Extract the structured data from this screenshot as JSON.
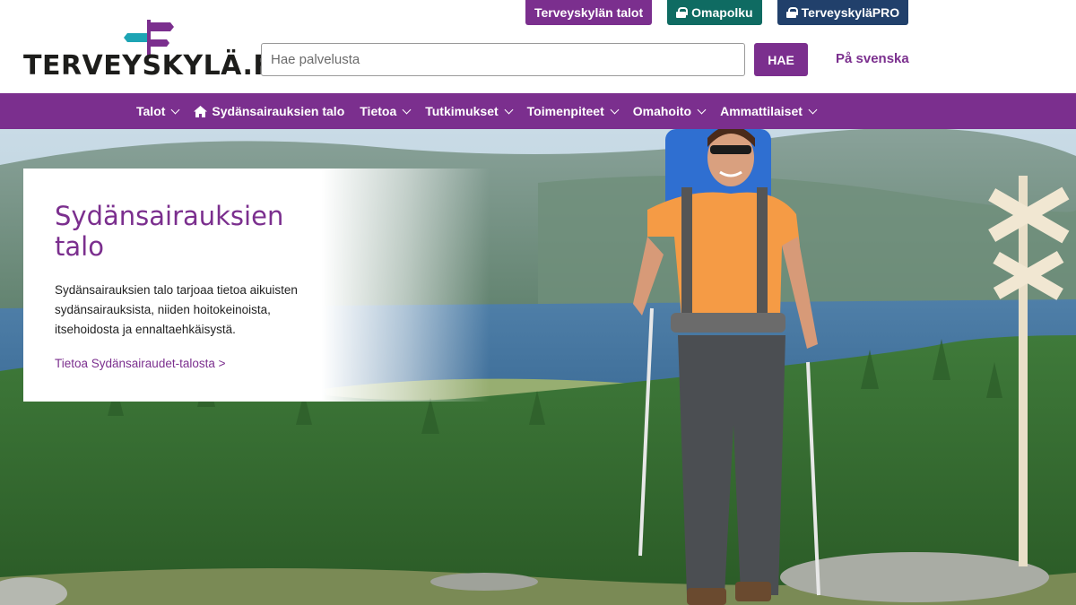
{
  "header": {
    "logo_text": "TERVEYSKYLÄ.FI",
    "top_links": [
      {
        "label": "Terveyskylän talot"
      },
      {
        "label": "Omapolku",
        "icon": "lock-icon"
      },
      {
        "label": "TerveyskyläPRO",
        "icon": "lock-icon"
      }
    ],
    "search": {
      "placeholder": "Hae palvelusta",
      "value": "",
      "button_label": "HAE"
    },
    "language_link": "På svenska"
  },
  "nav": {
    "items": [
      {
        "label": "Talot",
        "dropdown": true
      },
      {
        "label": "Sydänsairauksien talo",
        "icon": "home-icon"
      },
      {
        "label": "Tietoa",
        "dropdown": true
      },
      {
        "label": "Tutkimukset",
        "dropdown": true
      },
      {
        "label": "Toimenpiteet",
        "dropdown": true
      },
      {
        "label": "Omahoito",
        "dropdown": true
      },
      {
        "label": "Ammattilaiset",
        "dropdown": true
      }
    ]
  },
  "hero_card": {
    "title": "Sydänsairauksien talo",
    "body": "Sydänsairauksien talo tarjoaa tietoa aikuisten sydänsairauksista, niiden hoitokeinoista, itsehoidosta ja ennaltaehkäisystä.",
    "link": "Tietoa Sydänsairaudet-talosta >"
  },
  "colors": {
    "brand_purple": "#7b2f8e",
    "omapolku_teal": "#0f6b62",
    "pro_navy": "#21406b"
  }
}
